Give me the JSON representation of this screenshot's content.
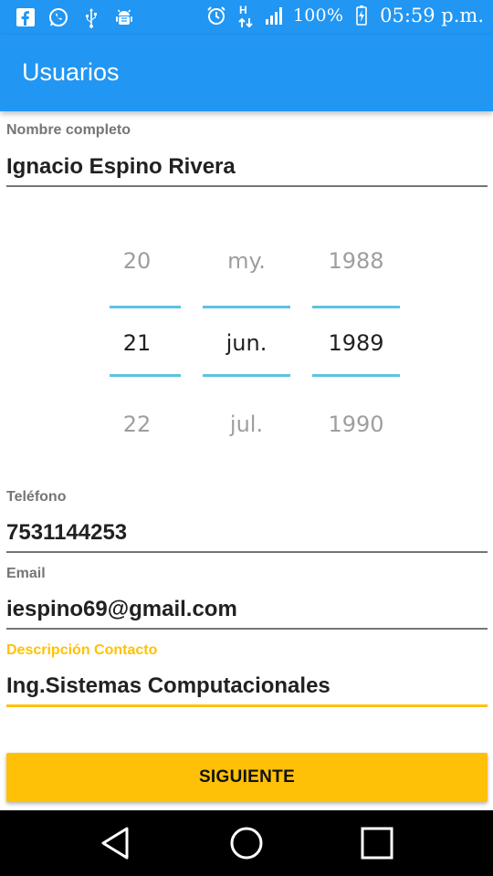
{
  "status_bar": {
    "battery": "100%",
    "time": "05:59 p.m.",
    "network_badge": "H",
    "icons_left": [
      "facebook-icon",
      "whatsapp-icon",
      "usb-icon",
      "android-debug-icon"
    ],
    "icons_right": [
      "alarm-icon",
      "data-transfer-icon",
      "signal-icon",
      "battery-charging-icon"
    ]
  },
  "app_bar": {
    "title": "Usuarios"
  },
  "form": {
    "name": {
      "label": "Nombre completo",
      "value": "Ignacio Espino Rivera"
    },
    "date_picker": {
      "day": {
        "prev": "20",
        "selected": "21",
        "next": "22"
      },
      "month": {
        "prev": "my.",
        "selected": "jun.",
        "next": "jul."
      },
      "year": {
        "prev": "1988",
        "selected": "1989",
        "next": "1990"
      }
    },
    "phone": {
      "label": "Teléfono",
      "value": "7531144253"
    },
    "email": {
      "label": "Email",
      "value": "iespino69@gmail.com"
    },
    "description": {
      "label": "Descripción Contacto",
      "value": "Ing.Sistemas Computacionales"
    }
  },
  "next_button": {
    "label": "SIGUIENTE"
  },
  "colors": {
    "primary": "#2196f3",
    "accent": "#ffc107",
    "picker_divider": "#5ec3e0",
    "nav_bar": "#000000"
  },
  "nav_bar": {
    "icons": [
      "back-icon",
      "home-icon",
      "recents-icon"
    ]
  }
}
